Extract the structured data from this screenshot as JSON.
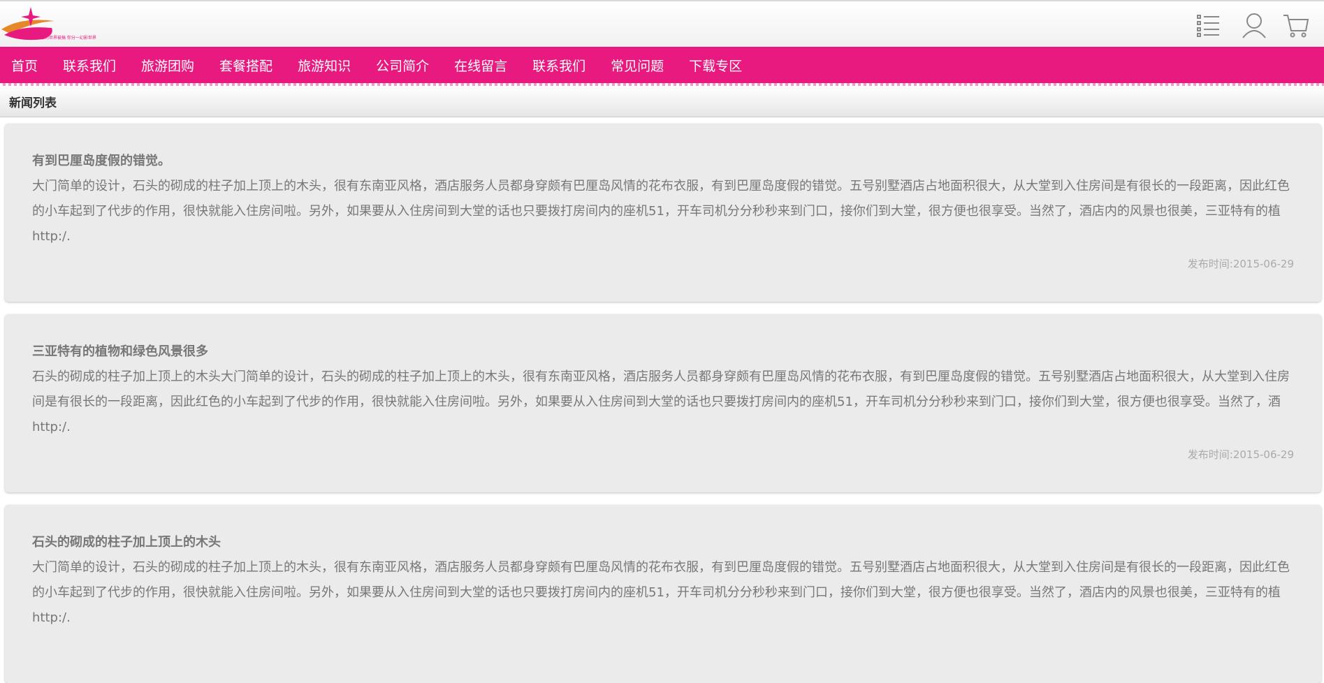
{
  "header": {
    "logo_text": "你的世界被搞 你分一幻影世界",
    "icons": [
      "menu-list-icon",
      "user-icon",
      "cart-icon"
    ]
  },
  "nav": {
    "items": [
      "首页",
      "联系我们",
      "旅游团购",
      "套餐搭配",
      "旅游知识",
      "公司简介",
      "在线留言",
      "联系我们",
      "常见问题",
      "下载专区"
    ]
  },
  "section": {
    "title": "新闻列表"
  },
  "news": [
    {
      "title": "有到巴厘岛度假的错觉。",
      "body": "大门简单的设计，石头的砌成的柱子加上顶上的木头，很有东南亚风格，酒店服务人员都身穿颇有巴厘岛风情的花布衣服，有到巴厘岛度假的错觉。五号别墅酒店占地面积很大，从大堂到入住房间是有很长的一段距离，因此红色的小车起到了代步的作用，很快就能入住房间啦。另外，如果要从入住房间到大堂的话也只要拨打房间内的座机51，开车司机分分秒秒来到门口，接你们到大堂，很方便也很享受。当然了，酒店内的风景也很美，三亚特有的植",
      "link": "http:/.",
      "date": "发布时间:2015-06-29"
    },
    {
      "title": "三亚特有的植物和绿色风景很多",
      "body": "石头的砌成的柱子加上顶上的木头大门简单的设计，石头的砌成的柱子加上顶上的木头，很有东南亚风格，酒店服务人员都身穿颇有巴厘岛风情的花布衣服，有到巴厘岛度假的错觉。五号别墅酒店占地面积很大，从大堂到入住房间是有很长的一段距离，因此红色的小车起到了代步的作用，很快就能入住房间啦。另外，如果要从入住房间到大堂的话也只要拨打房间内的座机51，开车司机分分秒秒来到门口，接你们到大堂，很方便也很享受。当然了，酒",
      "link": "http:/.",
      "date": "发布时间:2015-06-29"
    },
    {
      "title": "石头的砌成的柱子加上顶上的木头",
      "body": "大门简单的设计，石头的砌成的柱子加上顶上的木头，很有东南亚风格，酒店服务人员都身穿颇有巴厘岛风情的花布衣服，有到巴厘岛度假的错觉。五号别墅酒店占地面积很大，从大堂到入住房间是有很长的一段距离，因此红色的小车起到了代步的作用，很快就能入住房间啦。另外，如果要从入住房间到大堂的话也只要拨打房间内的座机51，开车司机分分秒秒来到门口，接你们到大堂，很方便也很享受。当然了，酒店内的风景也很美，三亚特有的植",
      "link": "http:/.",
      "date": ""
    }
  ],
  "colors": {
    "brand": "#e8197f",
    "logo_orange": "#e6872a",
    "card_bg": "#ebebeb"
  }
}
